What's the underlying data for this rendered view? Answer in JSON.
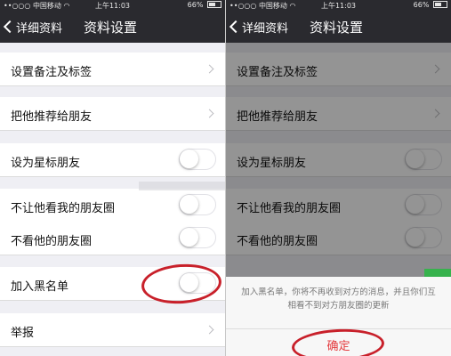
{
  "statusbar": {
    "signal": "••○○○",
    "carrier": "中国移动",
    "wifi_icon": "wifi-icon",
    "time": "上午11:03",
    "battery_percent": "66%",
    "battery_level": 0.66
  },
  "navbar": {
    "back_label": "详细资料",
    "title": "资料设置"
  },
  "rows": {
    "remark_tags": "设置备注及标签",
    "recommend": "把他推荐给朋友",
    "star_friend": "设为星标朋友",
    "hide_my_moments": "不让他看我的朋友圈",
    "hide_his_moments": "不看他的朋友圈",
    "blacklist": "加入黑名单",
    "report": "举报"
  },
  "toggles": {
    "star_friend": false,
    "hide_my_moments": false,
    "hide_his_moments": false,
    "blacklist": false
  },
  "dialog": {
    "message": "加入黑名单，你将不再收到对方的消息，并且你们互相看不到对方朋友圈的更新",
    "confirm_label": "确定"
  },
  "colors": {
    "navbar_bg": "#2a2a2f",
    "page_bg": "#efeff4",
    "confirm_text": "#e4393c",
    "annotation": "#c8202a",
    "switch_on": "#37b24d"
  }
}
